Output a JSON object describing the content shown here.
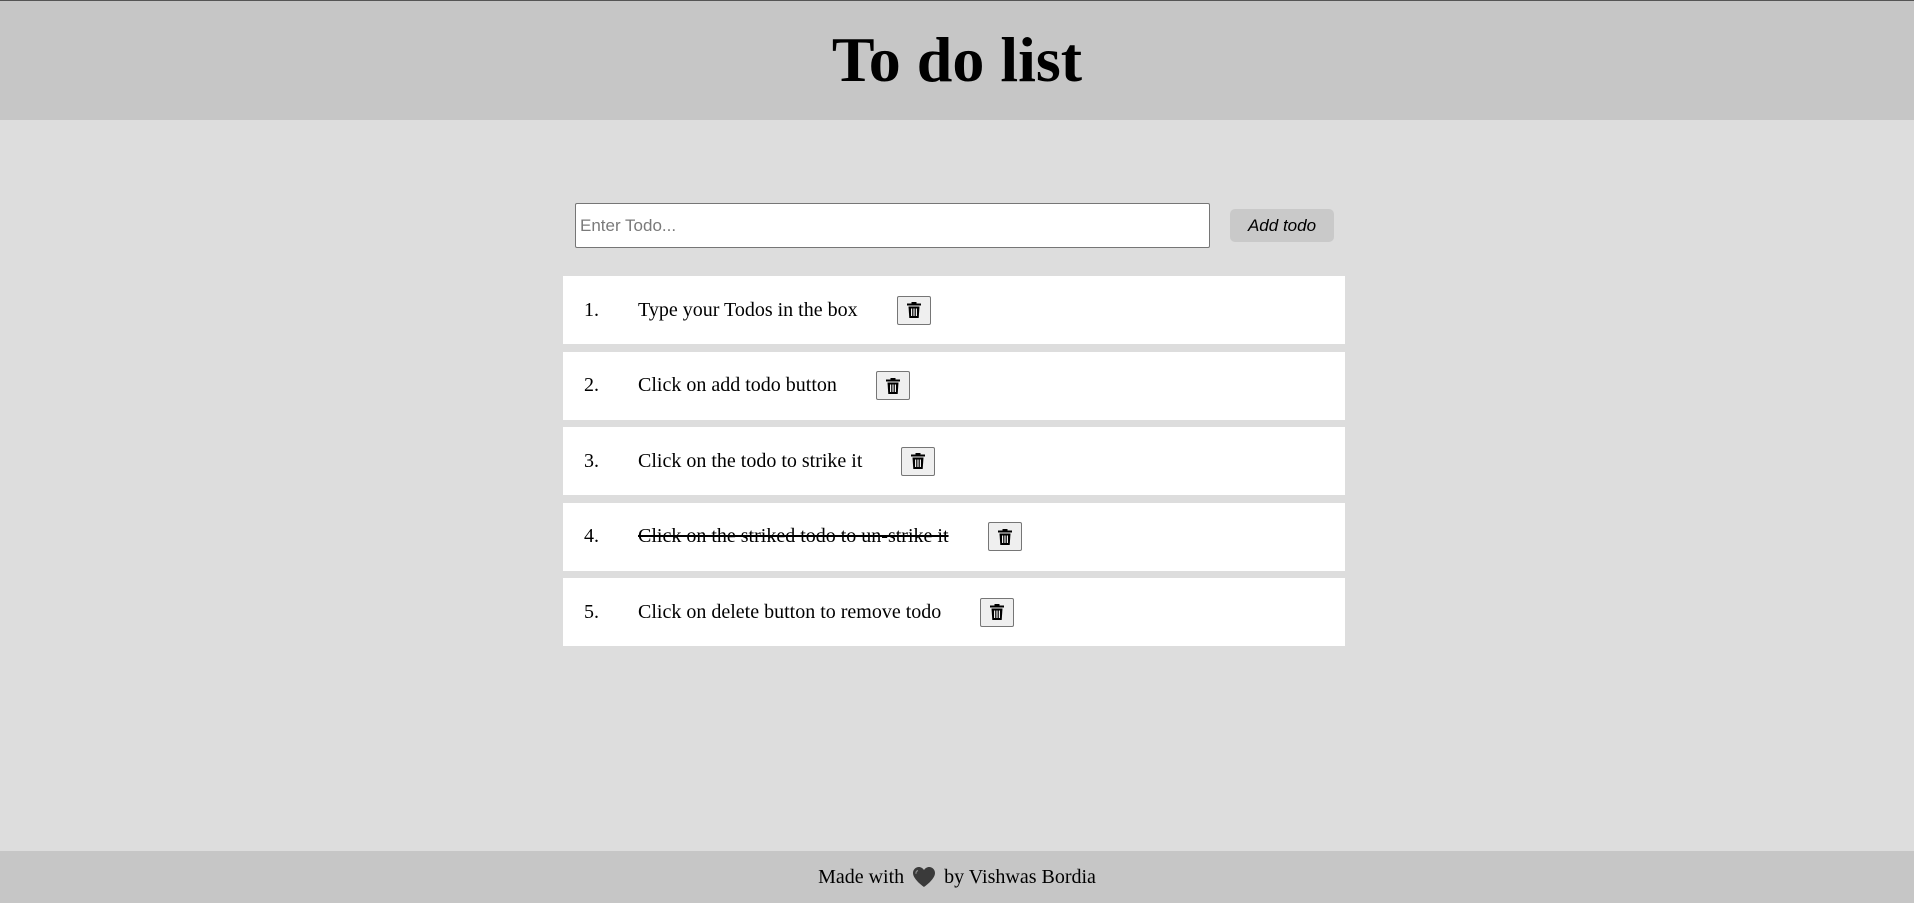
{
  "header": {
    "title": "To do list"
  },
  "input": {
    "placeholder": "Enter Todo...",
    "value": ""
  },
  "add_button": {
    "label": "Add todo"
  },
  "todos": [
    {
      "number": "1.",
      "text": "Type your Todos in the box",
      "struck": false
    },
    {
      "number": "2.",
      "text": "Click on add todo button",
      "struck": false
    },
    {
      "number": "3.",
      "text": "Click on the todo to strike it",
      "struck": false
    },
    {
      "number": "4.",
      "text": "Click on the striked todo to un-strike it",
      "struck": true
    },
    {
      "number": "5.",
      "text": "Click on delete button to remove todo",
      "struck": false
    }
  ],
  "delete_icon": "trash-icon",
  "footer": {
    "prefix": "Made with",
    "icon": "heart-icon",
    "suffix": "by Vishwas Bordia"
  },
  "colors": {
    "header_bg": "#c6c6c6",
    "page_bg": "#dddddd",
    "footer_bg": "#c6c6c6",
    "heart": "#3a3a3a"
  }
}
